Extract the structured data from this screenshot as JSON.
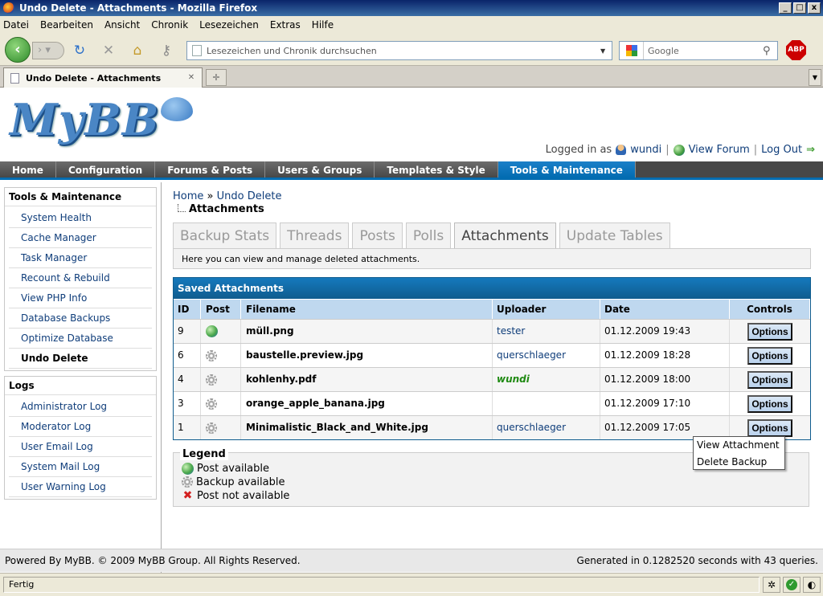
{
  "window": {
    "title": "Undo Delete - Attachments - Mozilla Firefox",
    "btn_min": "_",
    "btn_max": "□",
    "btn_close": "x"
  },
  "menubar": [
    "Datei",
    "Bearbeiten",
    "Ansicht",
    "Chronik",
    "Lesezeichen",
    "Extras",
    "Hilfe"
  ],
  "toolbar": {
    "url_placeholder": "Lesezeichen und Chronik durchsuchen",
    "search_placeholder": "Google",
    "abp": "ABP"
  },
  "browser_tab": {
    "label": "Undo Delete - Attachments"
  },
  "header": {
    "logo_text": "MyBB",
    "logged_in_as": "Logged in as",
    "username": "wundi",
    "view_forum": "View Forum",
    "log_out": "Log Out"
  },
  "mainnav": [
    "Home",
    "Configuration",
    "Forums & Posts",
    "Users & Groups",
    "Templates & Style",
    "Tools & Maintenance"
  ],
  "sidebar": {
    "tools_title": "Tools & Maintenance",
    "tools_items": [
      "System Health",
      "Cache Manager",
      "Task Manager",
      "Recount & Rebuild",
      "View PHP Info",
      "Database Backups",
      "Optimize Database",
      "Undo Delete"
    ],
    "logs_title": "Logs",
    "logs_items": [
      "Administrator Log",
      "Moderator Log",
      "User Email Log",
      "System Mail Log",
      "User Warning Log"
    ]
  },
  "breadcrumb": {
    "home": "Home",
    "sep": "»",
    "current": "Undo Delete",
    "sub": "Attachments"
  },
  "tabs": [
    "Backup Stats",
    "Threads",
    "Posts",
    "Polls",
    "Attachments",
    "Update Tables"
  ],
  "tab_description": "Here you can view and manage deleted attachments.",
  "table": {
    "title": "Saved Attachments",
    "columns": {
      "id": "ID",
      "post": "Post",
      "filename": "Filename",
      "uploader": "Uploader",
      "date": "Date",
      "controls": "Controls"
    },
    "rows": [
      {
        "id": "9",
        "post": "globe",
        "filename": "müll.png",
        "uploader": "tester",
        "date": "01.12.2009 19:43",
        "button": "Options"
      },
      {
        "id": "6",
        "post": "gear",
        "filename": "baustelle.preview.jpg",
        "uploader": "querschlaeger",
        "date": "01.12.2009 18:28",
        "button": "Options"
      },
      {
        "id": "4",
        "post": "gear",
        "filename": "kohlenhy.pdf",
        "uploader": "wundi",
        "date": "01.12.2009 18:00",
        "button": "Options"
      },
      {
        "id": "3",
        "post": "gear",
        "filename": "orange_apple_banana.jpg",
        "uploader": "",
        "date": "01.12.2009 17:10",
        "button": "Options"
      },
      {
        "id": "1",
        "post": "gear",
        "filename": "Minimalistic_Black_and_White.jpg",
        "uploader": "querschlaeger",
        "date": "01.12.2009 17:05",
        "button": "Options"
      }
    ]
  },
  "popup_menu": [
    "View Attachment",
    "Delete Backup"
  ],
  "legend": {
    "title": "Legend",
    "items": [
      "Post available",
      "Backup available",
      "Post not available"
    ]
  },
  "footer": {
    "left": "Powered By MyBB. © 2009 MyBB Group. All Rights Reserved.",
    "right": "Generated in 0.1282520 seconds with 43 queries."
  },
  "status": {
    "text": "Fertig"
  }
}
